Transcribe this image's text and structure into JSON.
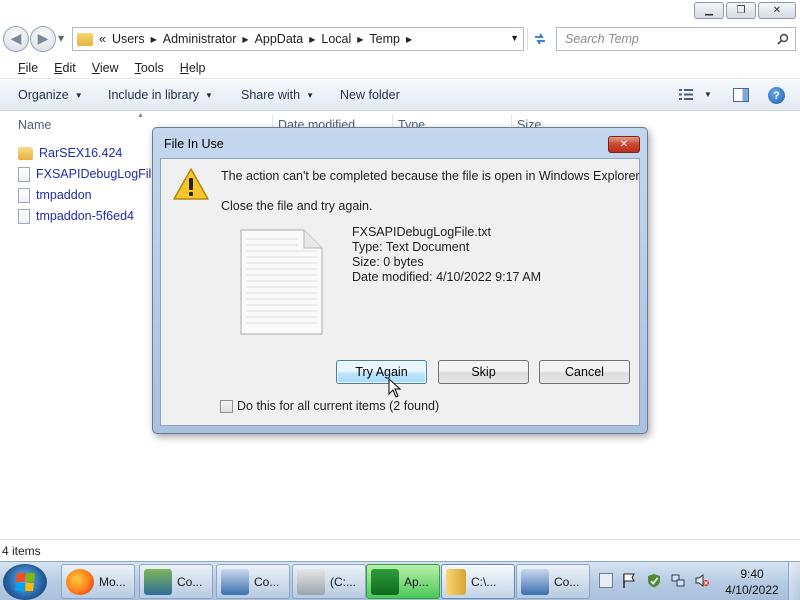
{
  "explorer": {
    "caption_buttons": {
      "minimize": "▁",
      "maximize": "❐",
      "close": "✕"
    },
    "nav": {
      "back": "◀",
      "forward": "▶"
    },
    "address": {
      "overflow": "«",
      "crumbs": [
        "Users",
        "Administrator",
        "AppData",
        "Local",
        "Temp"
      ],
      "crumb_separator": "▶"
    },
    "search": {
      "placeholder": "Search Temp"
    },
    "menu": [
      "File",
      "Edit",
      "View",
      "Tools",
      "Help"
    ],
    "commands": {
      "organize": "Organize",
      "include_in_library": "Include in library",
      "share_with": "Share with",
      "new_folder": "New folder",
      "dropdown_glyph": "▼",
      "help_glyph": "?"
    },
    "columns": [
      "Name",
      "Date modified",
      "Type",
      "Size"
    ],
    "files": [
      {
        "name": "RarSEX16.424",
        "icon": "folder-icon"
      },
      {
        "name": "FXSAPIDebugLogFile.txt",
        "icon": "text-file-icon"
      },
      {
        "name": "tmpaddon",
        "icon": "file-icon"
      },
      {
        "name": "tmpaddon-5f6ed4",
        "icon": "file-icon"
      }
    ],
    "status": "4 items"
  },
  "dialog": {
    "title": "File In Use",
    "close_glyph": "✕",
    "message": "The action can't be completed because the file is open in Windows Explorer",
    "instruction": "Close the file and try again.",
    "file": {
      "name": "FXSAPIDebugLogFile.txt",
      "type": "Type: Text Document",
      "size": "Size: 0 bytes",
      "modified": "Date modified: 4/10/2022 9:17 AM"
    },
    "buttons": {
      "try_again": "Try Again",
      "skip": "Skip",
      "cancel": "Cancel"
    },
    "checkbox_label": "Do this for all current items (2 found)"
  },
  "taskbar": {
    "items": [
      {
        "label": "Mo...",
        "icon": "firefox-icon"
      },
      {
        "label": "Co...",
        "icon": "computer-icon"
      },
      {
        "label": "Co...",
        "icon": "computer-icon"
      },
      {
        "label": "(C:...",
        "icon": "drive-icon"
      },
      {
        "label": "Ap...",
        "icon": "app-icon"
      },
      {
        "label": "C:\\...",
        "icon": "folder-icon"
      },
      {
        "label": "Co...",
        "icon": "computer-icon"
      }
    ],
    "clock": {
      "time": "9:40",
      "date": "4/10/2022"
    }
  },
  "colors": {
    "link_blue": "#1d2ea8",
    "dialog_frame": "#b7cde8",
    "default_button": "#bee6fd",
    "close_red": "#c8462f"
  }
}
